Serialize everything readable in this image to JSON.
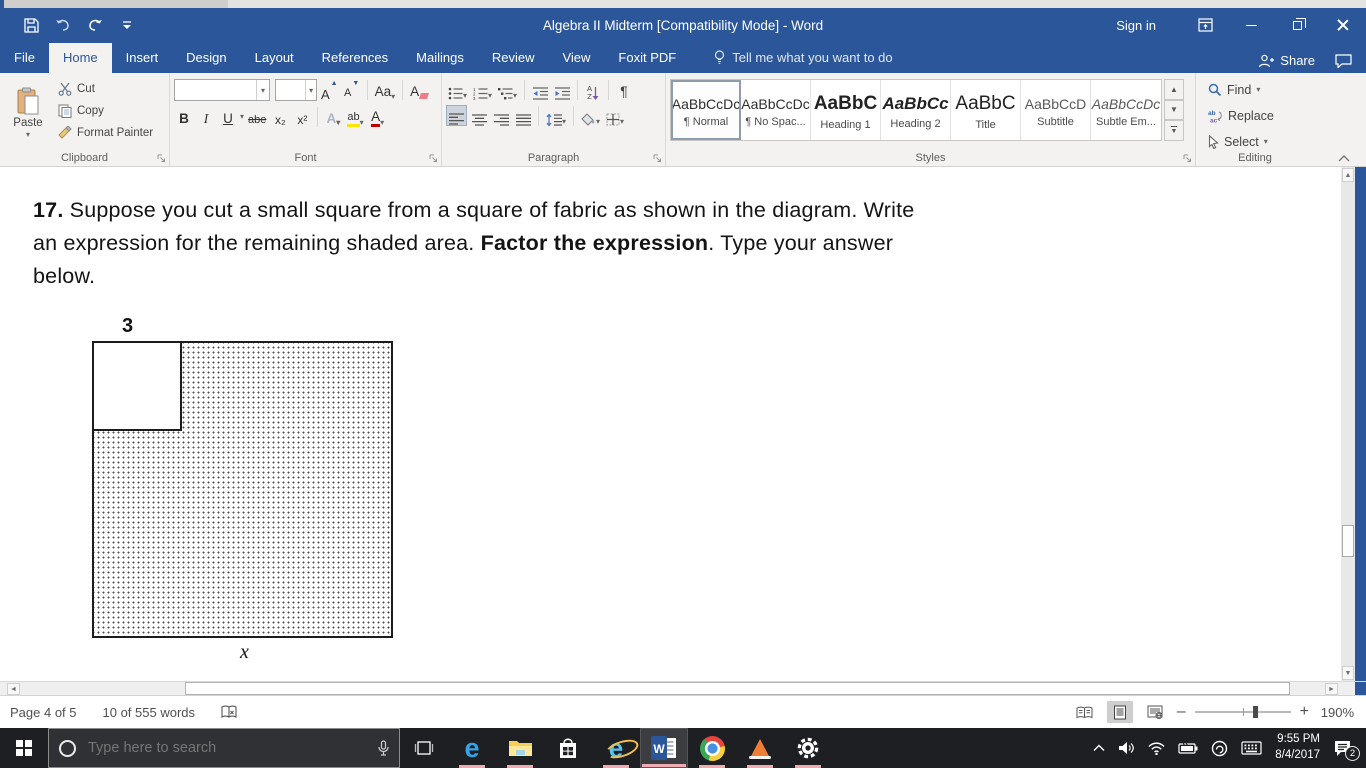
{
  "titlebar": {
    "title": "Algebra II Midterm [Compatibility Mode] - Word",
    "sign_in": "Sign in"
  },
  "tabs": [
    "File",
    "Home",
    "Insert",
    "Design",
    "Layout",
    "References",
    "Mailings",
    "Review",
    "View",
    "Foxit PDF"
  ],
  "tell_me": "Tell me what you want to do",
  "share_label": "Share",
  "ribbon": {
    "clipboard": {
      "group_label": "Clipboard",
      "paste": "Paste",
      "cut": "Cut",
      "copy": "Copy",
      "format_painter": "Format Painter"
    },
    "font": {
      "group_label": "Font",
      "bold": "B",
      "italic": "I",
      "underline": "U",
      "strikethrough": "abe",
      "subscript": "x₂",
      "superscript": "x²",
      "grow_font": "A",
      "shrink_font": "A",
      "change_case": "Aa",
      "clear_format": "A",
      "text_effects": "A",
      "highlight": "ab",
      "font_color": "A"
    },
    "paragraph": {
      "group_label": "Paragraph",
      "pilcrow": "¶",
      "sort_a": "A",
      "sort_z": "Z"
    },
    "styles": {
      "group_label": "Styles",
      "items": [
        {
          "sample": "AaBbCcDc",
          "name": "¶ Normal"
        },
        {
          "sample": "AaBbCcDc",
          "name": "¶ No Spac..."
        },
        {
          "sample": "AaBbC",
          "name": "Heading 1"
        },
        {
          "sample": "AaBbCc",
          "name": "Heading 2"
        },
        {
          "sample": "AaBbC",
          "name": "Title"
        },
        {
          "sample": "AaBbCcD",
          "name": "Subtitle"
        },
        {
          "sample": "AaBbCcDc",
          "name": "Subtle Em..."
        }
      ]
    },
    "editing": {
      "group_label": "Editing",
      "find": "Find",
      "replace": "Replace",
      "select": "Select"
    }
  },
  "document": {
    "line1": {
      "bold": "17.",
      "text": " Suppose you cut a small square from a square of fabric as shown in the diagram. Write"
    },
    "line2": {
      "pre": "an expression for the remaining shaded area. ",
      "bold": "Factor the expression",
      "post": ". Type your answer"
    },
    "line3": "below.",
    "diagram": {
      "top_label": "3",
      "bottom_label": "x"
    }
  },
  "statusbar": {
    "page": "Page 4 of 5",
    "word_count": "10 of 555 words",
    "zoom_out": "–",
    "zoom_in": "+",
    "zoom_level": "190%"
  },
  "taskbar": {
    "search_placeholder": "Type here to search",
    "clock_time": "9:55 PM",
    "clock_date": "8/4/2017",
    "notification_count": "2"
  },
  "colors": {
    "accent": "#2b579a",
    "running_indicator": "#edacb2",
    "taskbar": "#1e1f22"
  }
}
